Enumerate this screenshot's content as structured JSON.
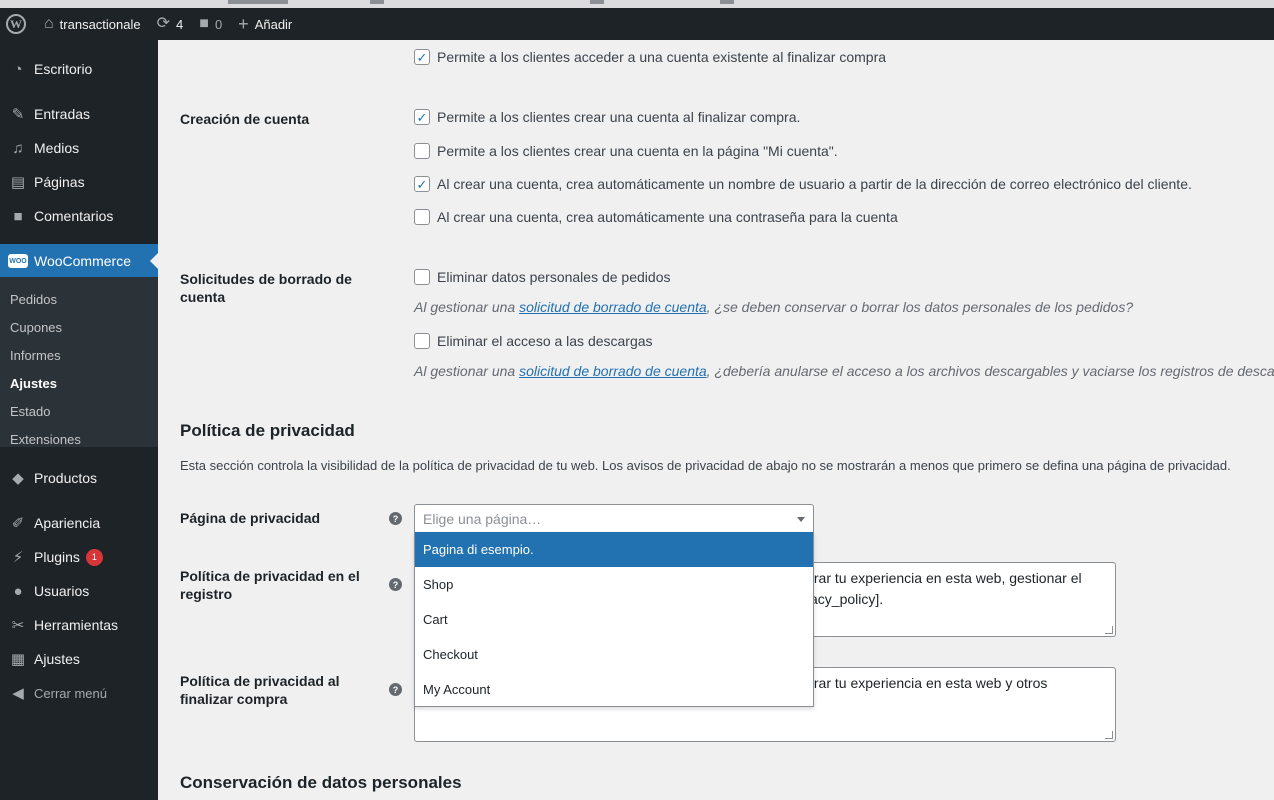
{
  "adminbar": {
    "site_name": "transactionale",
    "updates_count": "4",
    "comments_count": "0",
    "add_new_label": "Añadir"
  },
  "sidebar": {
    "items": [
      {
        "label": "Escritorio",
        "icon": "dashboard-icon"
      },
      {
        "label": "Entradas",
        "icon": "pin-icon"
      },
      {
        "label": "Medios",
        "icon": "media-icon"
      },
      {
        "label": "Páginas",
        "icon": "pages-icon"
      },
      {
        "label": "Comentarios",
        "icon": "comment-icon"
      },
      {
        "label": "WooCommerce",
        "icon": "woo-icon"
      },
      {
        "label": "Productos",
        "icon": "box-icon"
      },
      {
        "label": "Apariencia",
        "icon": "brush-icon"
      },
      {
        "label": "Plugins",
        "icon": "plug-icon",
        "badge": "1"
      },
      {
        "label": "Usuarios",
        "icon": "user-icon"
      },
      {
        "label": "Herramientas",
        "icon": "wrench-icon"
      },
      {
        "label": "Ajustes",
        "icon": "settings-icon"
      }
    ],
    "woo_submenu": [
      "Pedidos",
      "Cupones",
      "Informes",
      "Ajustes",
      "Estado",
      "Extensiones"
    ],
    "woo_submenu_current": "Ajustes",
    "collapse_label": "Cerrar menú"
  },
  "main": {
    "login_option": "Permite a los clientes acceder a una cuenta existente al finalizar compra",
    "account_creation": {
      "label": "Creación de cuenta",
      "options": [
        {
          "text": "Permite a los clientes crear una cuenta al finalizar compra.",
          "checked": true
        },
        {
          "text": "Permite a los clientes crear una cuenta en la página \"Mi cuenta\".",
          "checked": false
        },
        {
          "text": "Al crear una cuenta, crea automáticamente un nombre de usuario a partir de la dirección de correo electrónico del cliente.",
          "checked": true
        },
        {
          "text": "Al crear una cuenta, crea automáticamente una contraseña para la cuenta",
          "checked": false
        }
      ]
    },
    "erasure": {
      "label": "Solicitudes de borrado de cuenta",
      "option1": "Eliminar datos personales de pedidos",
      "desc1_prefix": "Al gestionar una ",
      "desc1_link": "solicitud de borrado de cuenta",
      "desc1_suffix": ", ¿se deben conservar o borrar los datos personales de los pedidos?",
      "option2": "Eliminar el acceso a las descargas",
      "desc2_prefix": "Al gestionar una ",
      "desc2_link": "solicitud de borrado de cuenta",
      "desc2_suffix": ", ¿debería anularse el acceso a los archivos descargables y vaciarse los registros de descarga?"
    },
    "privacy": {
      "title": "Política de privacidad",
      "description": "Esta sección controla la visibilidad de la política de privacidad de tu web. Los avisos de privacidad de abajo no se mostrarán a menos que primero se defina una página de privacidad.",
      "page_label": "Página de privacidad",
      "select_placeholder": "Elige una página…",
      "dropdown_options": [
        "Pagina di esempio.",
        "Shop",
        "Cart",
        "Checkout",
        "My Account"
      ],
      "dropdown_highlighted": "Pagina di esempio.",
      "registration_label": "Política de privacidad en el registro",
      "registration_text_line1": "jorar tu experiencia en esta web, gestionar el",
      "registration_text_line2": "vacy_policy].",
      "checkout_label": "Política de privacidad al finalizar compra",
      "checkout_text_line1": "jorar tu experiencia en esta web y otros"
    },
    "retention": {
      "title": "Conservación de datos personales"
    }
  },
  "colors": {
    "accent": "#2271b1",
    "admin_dark": "#1d2327",
    "badge": "#d63638"
  }
}
